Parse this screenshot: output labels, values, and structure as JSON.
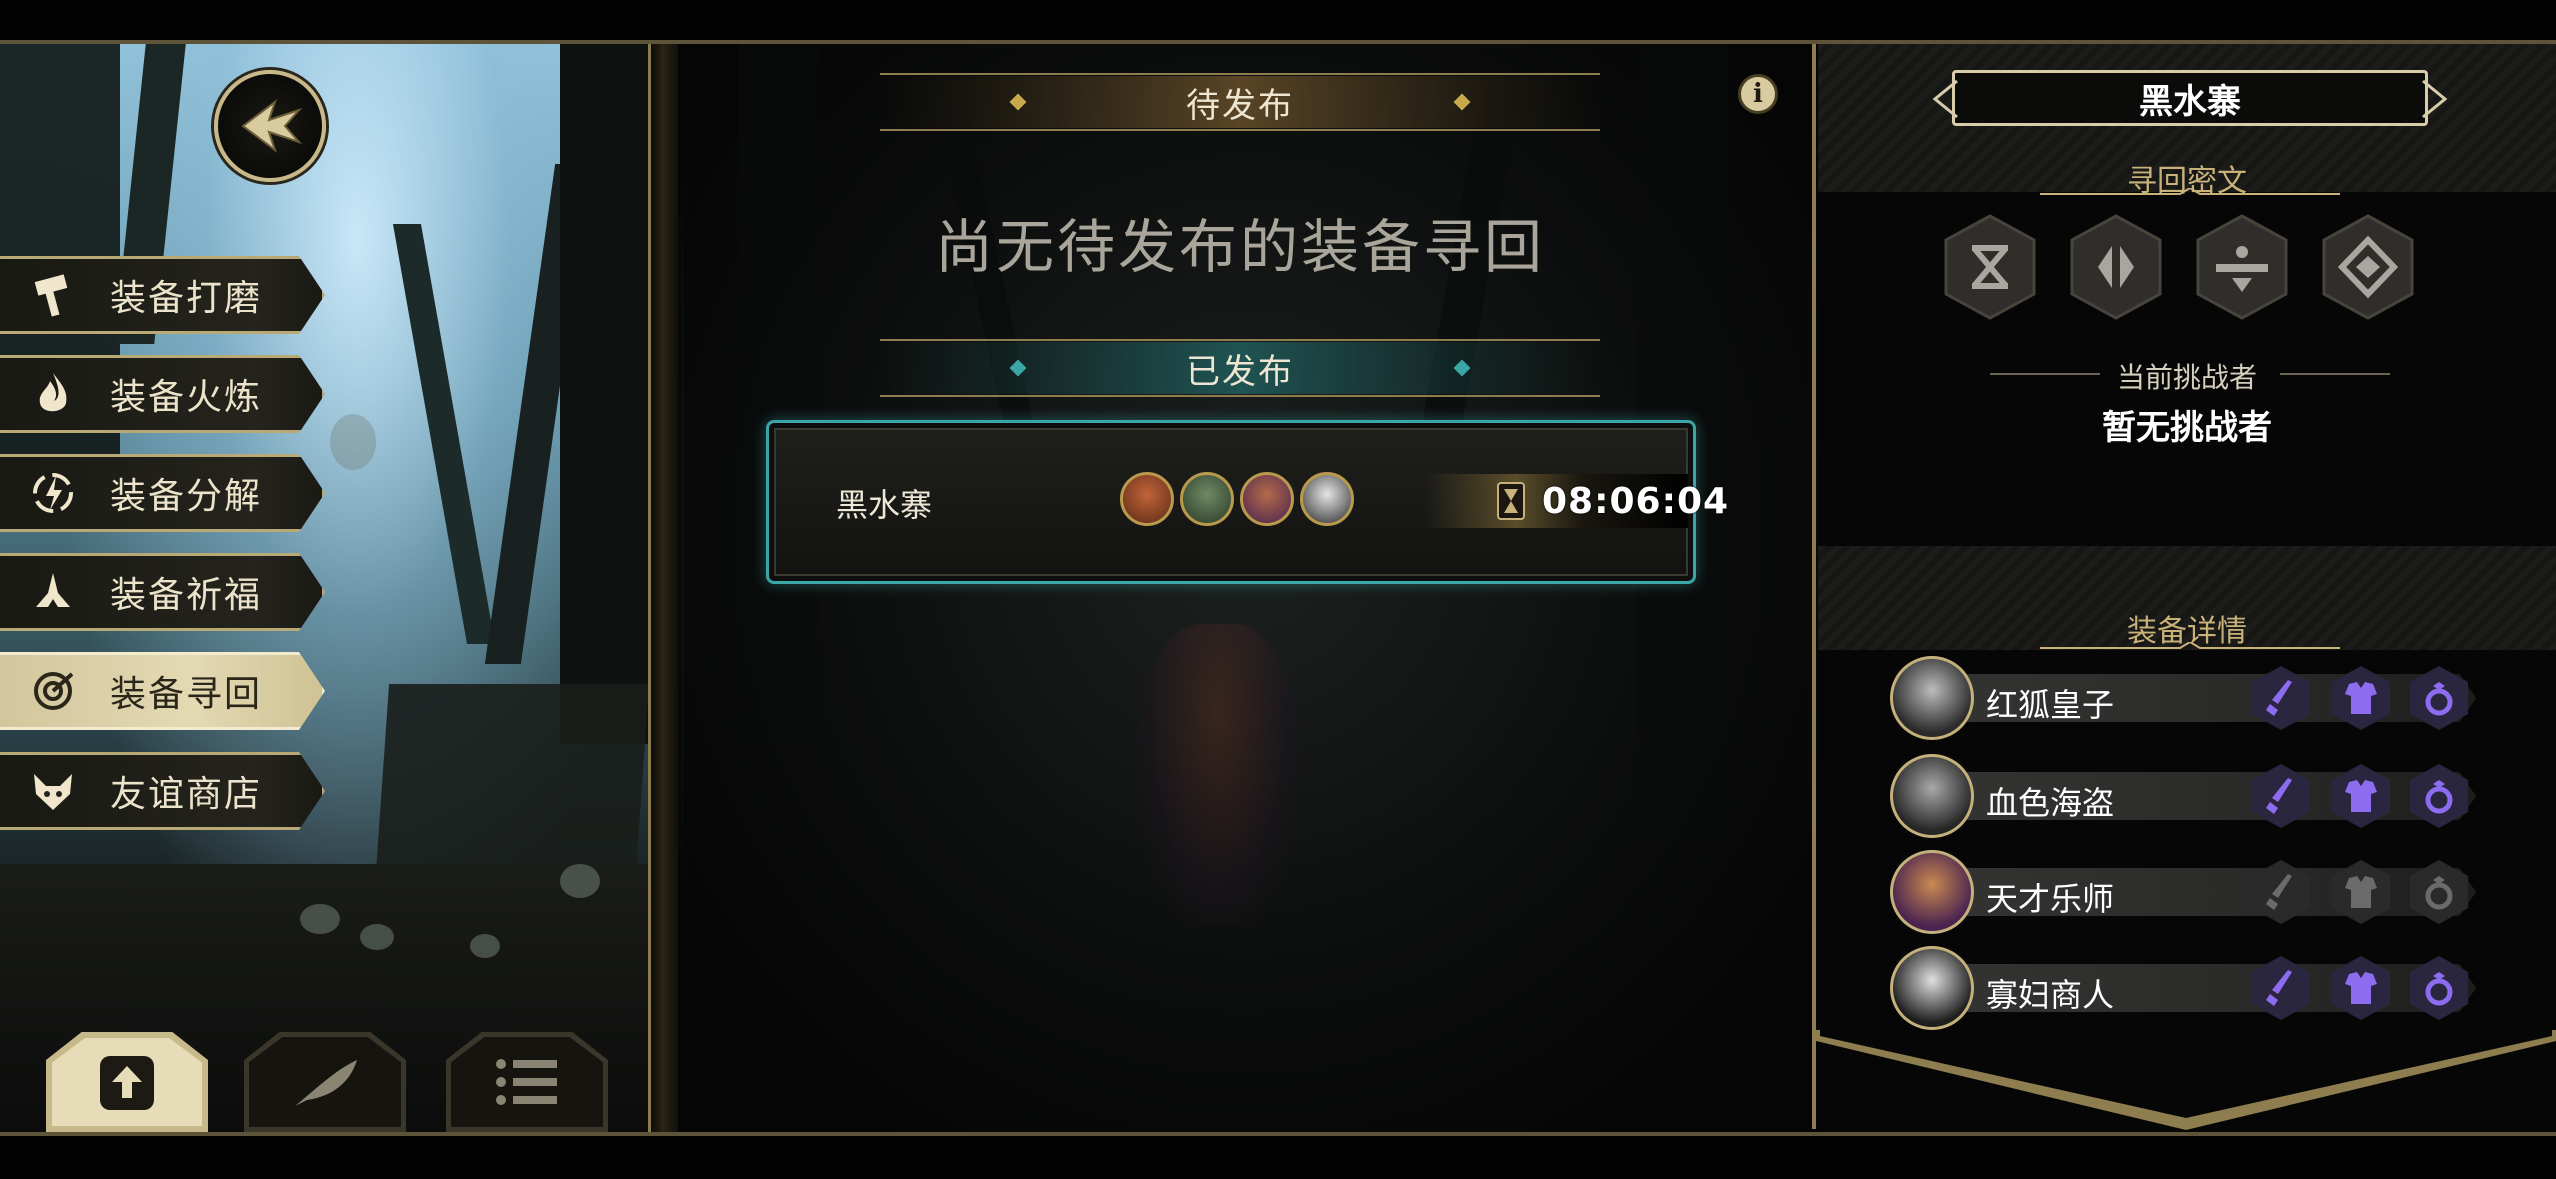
{
  "nav": {
    "menu_items": [
      {
        "label": "装备打磨",
        "icon": "hammer-icon",
        "selected": false
      },
      {
        "label": "装备火炼",
        "icon": "flame-icon",
        "selected": false
      },
      {
        "label": "装备分解",
        "icon": "disassemble-icon",
        "selected": false
      },
      {
        "label": "装备祈福",
        "icon": "praying-hands-icon",
        "selected": false
      },
      {
        "label": "装备寻回",
        "icon": "target-icon",
        "selected": true
      },
      {
        "label": "友谊商店",
        "icon": "fox-icon",
        "selected": false
      }
    ],
    "bottom_tabs": [
      {
        "icon": "upload-document-icon",
        "active": true
      },
      {
        "icon": "feather-icon",
        "active": false
      },
      {
        "icon": "list-icon",
        "active": false
      }
    ]
  },
  "center": {
    "pending_header": "待发布",
    "empty_message": "尚无待发布的装备寻回",
    "published_header": "已发布",
    "mission": {
      "name": "黑水寨",
      "avatars": [
        "red-fox-avatar",
        "crocodile-avatar",
        "dog-musician-avatar",
        "badger-avatar"
      ],
      "timer": "08:06:04"
    }
  },
  "right": {
    "location": "黑水寨",
    "cipher_title": "寻回密文",
    "cipher_icons": [
      "cipher-glyph-x-icon",
      "cipher-glyph-split-icon",
      "cipher-glyph-bar-icon",
      "cipher-glyph-diamond-icon"
    ],
    "challenger_label": "当前挑战者",
    "challenger_value": "暂无挑战者",
    "equip_title": "装备详情",
    "equipment": [
      {
        "name": "红狐皇子",
        "slots_active": true
      },
      {
        "name": "血色海盗",
        "slots_active": true
      },
      {
        "name": "天才乐师",
        "slots_active": false
      },
      {
        "name": "寡妇商人",
        "slots_active": true
      }
    ]
  },
  "colors": {
    "gold": "#c9b27a",
    "teal": "#3aa6a8",
    "purple_slot": "#8d6cf0",
    "grey_slot": "#6b6b6b"
  }
}
